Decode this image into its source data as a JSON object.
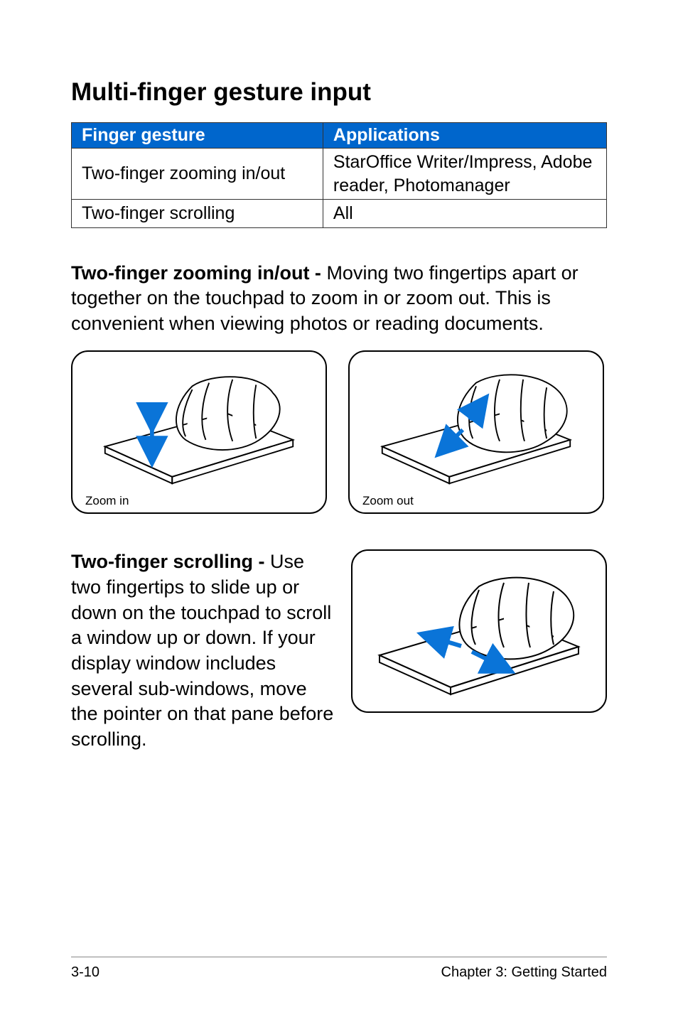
{
  "heading": "Multi-finger gesture input",
  "table": {
    "headers": [
      "Finger gesture",
      "Applications"
    ],
    "rows": [
      [
        "Two-finger zooming in/out",
        "StarOffice Writer/Impress, Adobe reader, Photomanager"
      ],
      [
        "Two-finger scrolling",
        "All"
      ]
    ]
  },
  "para_zoom_bold": "Two-finger zooming in/out - ",
  "para_zoom_rest": "Moving two fingertips apart or together on the touchpad to zoom in or zoom out. This is convenient when viewing photos or reading documents.",
  "caption_zoom_in": "Zoom in",
  "caption_zoom_out": "Zoom out",
  "para_scroll_bold": "Two-finger scrolling - ",
  "para_scroll_rest": "Use two fingertips to slide up or down on the touchpad to scroll a window up or down. If your display window includes several sub-windows, move the pointer on that pane before scrolling.",
  "footer_left": "3-10",
  "footer_right": "Chapter 3: Getting Started"
}
